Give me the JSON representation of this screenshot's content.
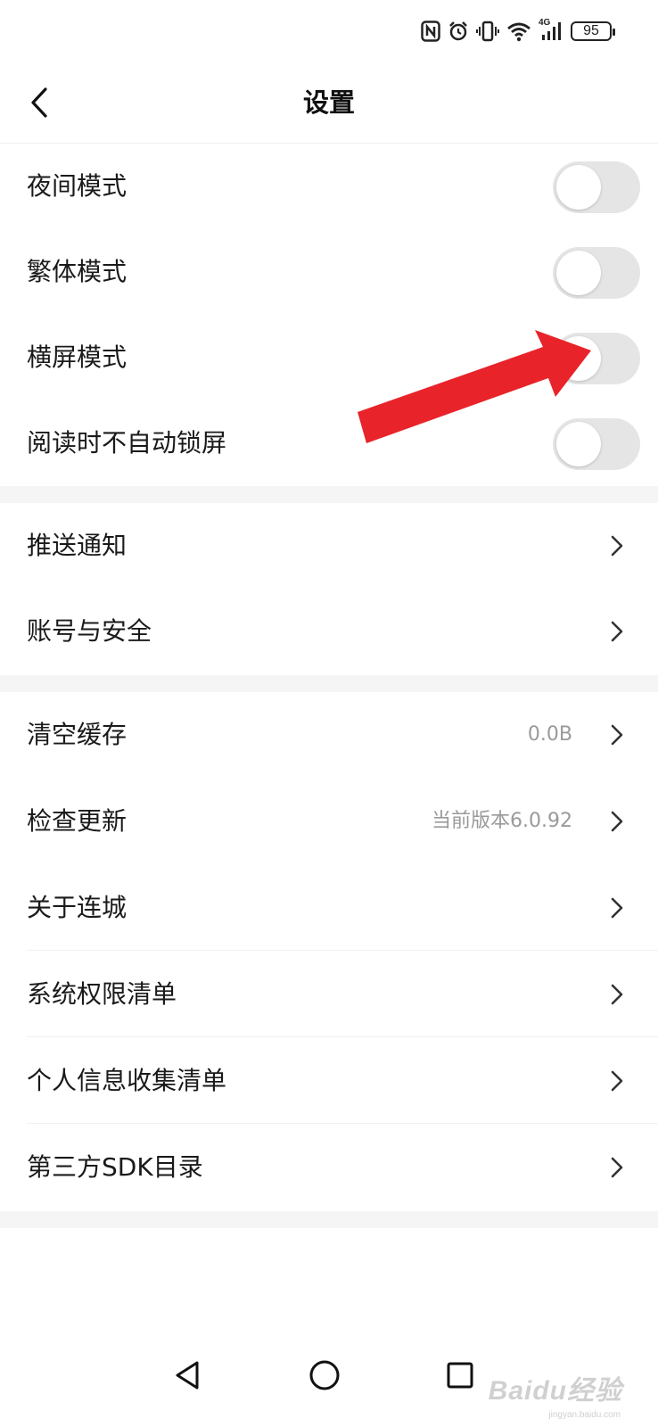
{
  "status_bar": {
    "battery_level": "95",
    "icons": [
      "nfc-icon",
      "alarm-icon",
      "vibrate-icon",
      "wifi-icon",
      "signal-4g-icon",
      "battery-icon"
    ],
    "network_label": "4G"
  },
  "header": {
    "title": "设置",
    "back_icon": "chevron-left-icon"
  },
  "toggle_section": {
    "items": [
      {
        "label": "夜间模式",
        "enabled": false
      },
      {
        "label": "繁体模式",
        "enabled": false
      },
      {
        "label": "横屏模式",
        "enabled": false
      },
      {
        "label": "阅读时不自动锁屏",
        "enabled": false
      }
    ]
  },
  "account_section": {
    "items": [
      {
        "label": "推送通知"
      },
      {
        "label": "账号与安全"
      }
    ]
  },
  "info_section": {
    "items": [
      {
        "label": "清空缓存",
        "value": "0.0B"
      },
      {
        "label": "检查更新",
        "value": "当前版本6.0.92"
      },
      {
        "label": "关于连城"
      },
      {
        "label": "系统权限清单"
      },
      {
        "label": "个人信息收集清单"
      },
      {
        "label": "第三方SDK目录"
      }
    ]
  },
  "annotation": {
    "color": "#e8232a",
    "target": "横屏模式 toggle"
  },
  "nav_bar": {
    "icons": [
      "back-triangle-icon",
      "home-circle-icon",
      "recents-square-icon"
    ]
  },
  "watermark": {
    "brand": "Baidu经验",
    "url": "jingyan.baidu.com"
  },
  "colors": {
    "toggle_off": "#e5e5e5",
    "section_gap": "#f5f5f5",
    "secondary_text": "#9a9a9a"
  }
}
